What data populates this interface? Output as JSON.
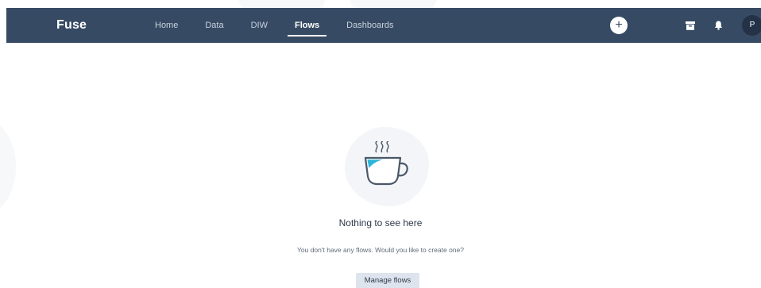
{
  "navbar": {
    "brand": "Fuse",
    "links": [
      {
        "label": "Home"
      },
      {
        "label": "Data"
      },
      {
        "label": "DIW"
      },
      {
        "label": "Flows"
      },
      {
        "label": "Dashboards"
      }
    ],
    "active_link": "Flows",
    "add_label": "+",
    "avatar_initial": "P",
    "icons": [
      "add-icon",
      "archive-icon",
      "bell-icon"
    ]
  },
  "empty_state": {
    "title": "Nothing to see here",
    "description": "You don't have any flows. Would you like to create one?",
    "button_label": "Manage flows",
    "illustration": "coffee-cup-icon"
  },
  "colors": {
    "navbar_bg": "#364a63",
    "accent": "#2cb5d8",
    "button_bg": "#dde4ee"
  }
}
